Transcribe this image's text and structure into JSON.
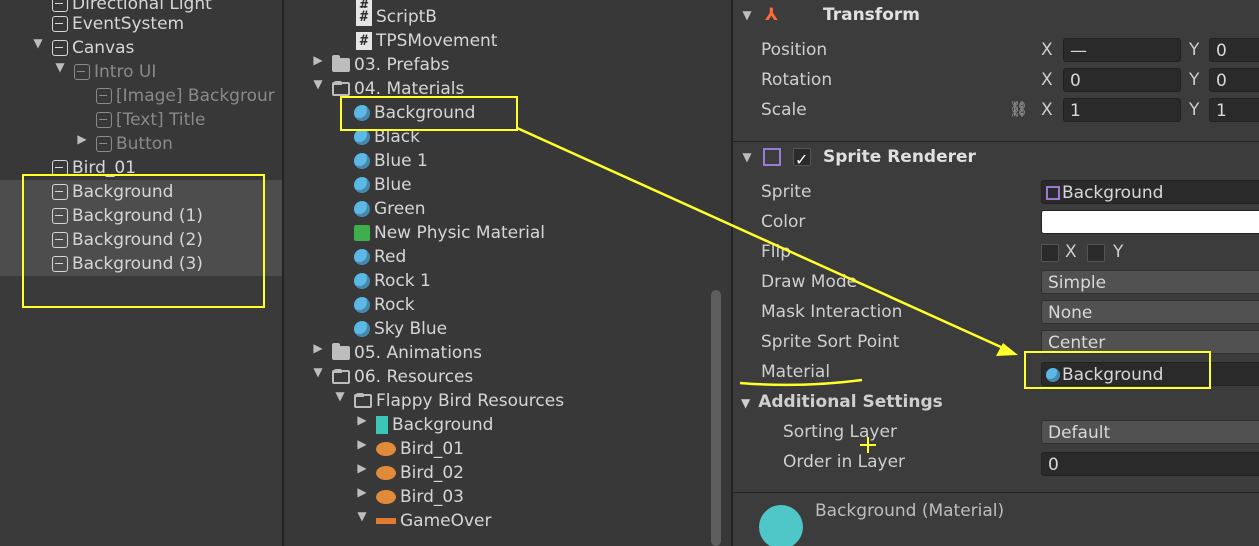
{
  "hierarchy": {
    "items": [
      {
        "label": "Directional Light"
      },
      {
        "label": "EventSystem"
      },
      {
        "label": "Canvas"
      },
      {
        "label": "Intro UI"
      },
      {
        "label": "[Image] Backgrour"
      },
      {
        "label": "[Text] Title"
      },
      {
        "label": "Button"
      },
      {
        "label": "Bird_01"
      },
      {
        "label": "Background"
      },
      {
        "label": "Background (1)"
      },
      {
        "label": "Background (2)"
      },
      {
        "label": "Background (3)"
      }
    ]
  },
  "project": {
    "items": [
      {
        "label": "ScriptB"
      },
      {
        "label": "TPSMovement"
      },
      {
        "label": "03. Prefabs"
      },
      {
        "label": "04. Materials"
      },
      {
        "label": "Background"
      },
      {
        "label": "Black"
      },
      {
        "label": "Blue 1"
      },
      {
        "label": "Blue"
      },
      {
        "label": "Green"
      },
      {
        "label": "New Physic Material"
      },
      {
        "label": "Red"
      },
      {
        "label": "Rock 1"
      },
      {
        "label": "Rock"
      },
      {
        "label": "Sky Blue"
      },
      {
        "label": "05. Animations"
      },
      {
        "label": "06. Resources"
      },
      {
        "label": "Flappy Bird Resources"
      },
      {
        "label": "Background"
      },
      {
        "label": "Bird_01"
      },
      {
        "label": "Bird_02"
      },
      {
        "label": "Bird_03"
      },
      {
        "label": "GameOver"
      }
    ]
  },
  "inspector": {
    "transform": {
      "title": "Transform",
      "position_label": "Position",
      "position_x": "—",
      "position_y": "0",
      "rotation_label": "Rotation",
      "rotation_x": "0",
      "rotation_y": "0",
      "scale_label": "Scale",
      "scale_x": "1",
      "scale_y": "1",
      "x": "X",
      "y": "Y"
    },
    "sprite_renderer": {
      "title": "Sprite Renderer",
      "sprite_label": "Sprite",
      "sprite_value": "Background",
      "color_label": "Color",
      "flip_label": "Flip",
      "flip_x": "X",
      "flip_y": "Y",
      "draw_mode_label": "Draw Mode",
      "draw_mode_value": "Simple",
      "mask_label": "Mask Interaction",
      "mask_value": "None",
      "sort_point_label": "Sprite Sort Point",
      "sort_point_value": "Center",
      "material_label": "Material",
      "material_value": "Background",
      "additional_label": "Additional Settings",
      "sorting_layer_label": "Sorting Layer",
      "sorting_layer_value": "Default",
      "order_label": "Order in Layer",
      "order_value": "0"
    },
    "material": {
      "title": "Background (Material)"
    }
  },
  "colors": {
    "highlight": "#ffff2a",
    "material_preview": "#4fc6c8"
  }
}
